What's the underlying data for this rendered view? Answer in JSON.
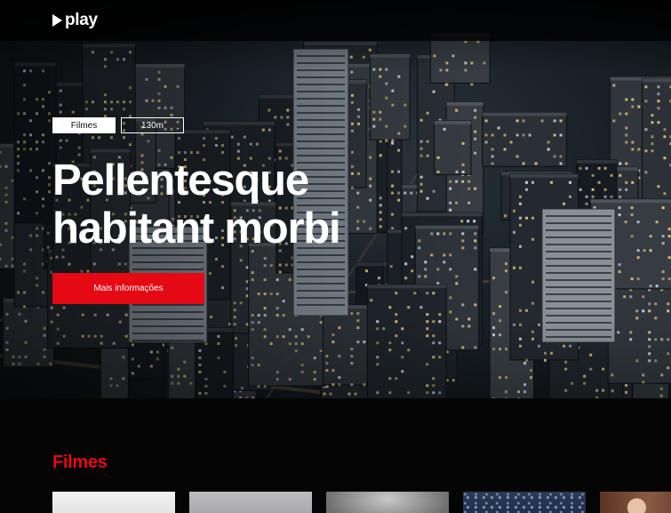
{
  "app": {
    "logo_text": "play",
    "logo_icon": "play-triangle-icon"
  },
  "hero": {
    "category_tag": "Filmes",
    "duration_tag": "130m",
    "title": "Pellentesque habitant morbi",
    "cta_label": "Mais informações",
    "background": "night-city-aerial-image"
  },
  "section": {
    "title": "Filmes"
  },
  "cards": [
    {
      "thumbnail": "white-gradient-thumbnail"
    },
    {
      "thumbnail": "grey-fabric-thumbnail"
    },
    {
      "thumbnail": "blurred-grey-thumbnail"
    },
    {
      "thumbnail": "night-sky-thumbnail"
    },
    {
      "thumbnail": "portrait-thumbnail"
    }
  ],
  "colors": {
    "accent": "#e50914",
    "background": "#050505",
    "text": "#ffffff"
  }
}
